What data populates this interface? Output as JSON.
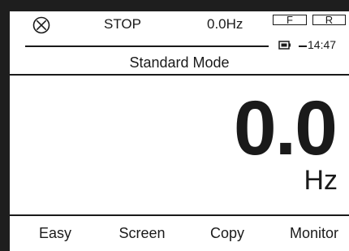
{
  "status_bar": {
    "run_status": "STOP",
    "frequency_reference": "0.0Hz",
    "direction_forward": "F",
    "direction_reverse": "R",
    "clock": "14:47",
    "stop_icon": "circle-x-icon",
    "battery_icon": "battery-icon"
  },
  "mode": {
    "title": "Standard Mode"
  },
  "monitor": {
    "value": "0.0",
    "unit": "Hz"
  },
  "softkeys": {
    "f1": "Easy",
    "f2": "Screen",
    "f3": "Copy",
    "f4": "Monitor"
  }
}
